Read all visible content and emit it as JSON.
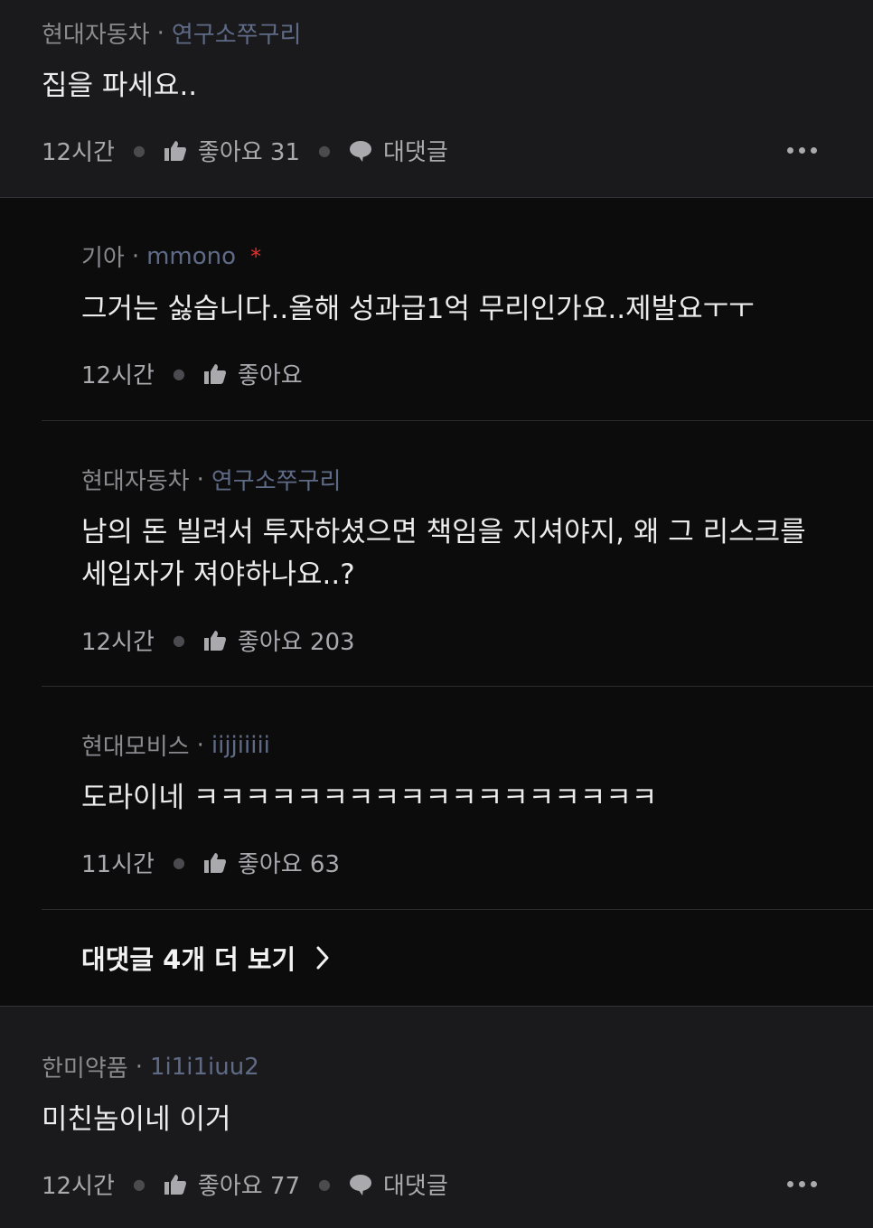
{
  "comments": [
    {
      "company": "현대자동차",
      "nickname": "연구소쭈구리",
      "text": "집을 파세요..",
      "time": "12시간",
      "like_label": "좋아요 31",
      "reply_label": "대댓글"
    },
    {
      "company": "한미약품",
      "nickname": "1i1i1iuu2",
      "text": "미친놈이네 이거",
      "time": "12시간",
      "like_label": "좋아요 77",
      "reply_label": "대댓글"
    }
  ],
  "replies": [
    {
      "company": "기아",
      "nickname": "mmono",
      "author_marker": "*",
      "text": "그거는 싫습니다..올해 성과급1억 무리인가요..제발요ㅜㅜ",
      "time": "12시간",
      "like_label": "좋아요"
    },
    {
      "company": "현대자동차",
      "nickname": "연구소쭈구리",
      "text_line1": "남의 돈 빌려서 투자하셨으면 책임을 지셔야지, 왜 그 리스크를",
      "text_line2": "세입자가 져야하나요..?",
      "time": "12시간",
      "like_label": "좋아요 203"
    },
    {
      "company": "현대모비스",
      "nickname": "iijjiiiii",
      "text": "도라이네 ㅋㅋㅋㅋㅋㅋㅋㅋㅋㅋㅋㅋㅋㅋㅋㅋㅋㅋ",
      "time": "11시간",
      "like_label": "좋아요 63"
    }
  ],
  "view_more_replies": "대댓글 4개 더 보기",
  "icons": {
    "like": "thumbs-up-icon",
    "reply": "speech-bubble-icon",
    "more": "more-horizontal-icon",
    "chevron": "chevron-right-icon"
  },
  "colors": {
    "background": "#1a1a1c",
    "reply_background": "#0c0c0d",
    "nickname": "#5f6b86",
    "author_marker": "#e0322b"
  }
}
